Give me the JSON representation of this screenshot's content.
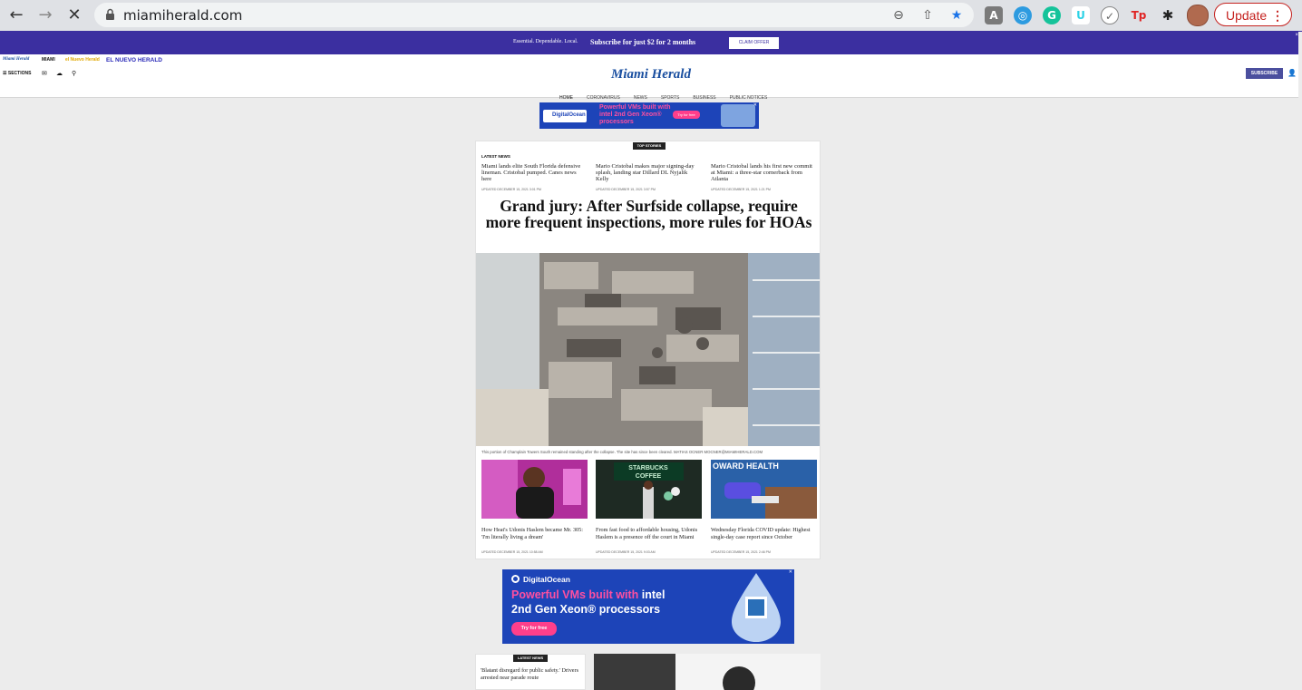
{
  "browser": {
    "url": "miamiherald.com",
    "update_label": "Update",
    "update_dots": "⋮",
    "extensions": [
      {
        "name": "A",
        "color": "#7a7a7a"
      },
      {
        "name": "◎",
        "color": "#2d9be0"
      },
      {
        "name": "G",
        "color": "#15c39a"
      },
      {
        "name": "U",
        "color": "#2dd2e6"
      },
      {
        "name": "✓",
        "color": "#888888"
      },
      {
        "name": "Tp",
        "color": "#e02424"
      },
      {
        "name": "✱",
        "color": "#222222"
      }
    ]
  },
  "promo": {
    "tagline": "Essential. Dependable. Local.",
    "offer": "Subscribe for just $2 for 2 months",
    "claim_label": "CLAIM OFFER",
    "close": "×"
  },
  "sister_sites": [
    "Miami Herald",
    "MIAMI",
    "el Nuevo Herald",
    "EL NUEVO HERALD"
  ],
  "masthead": {
    "logo": "Miami Herald",
    "sections_label": "SECTIONS",
    "subscribe_label": "SUBSCRIBE",
    "nav": [
      "HOME",
      "CORONAVIRUS",
      "NEWS",
      "SPORTS",
      "BUSINESS",
      "PUBLIC NOTICES"
    ]
  },
  "ad_top": {
    "brand": "DigitalOcean",
    "headline": "Powerful VMs built with intel 2nd Gen Xeon® processors",
    "cta": "Try for free"
  },
  "top_stories": {
    "badge": "TOP STORIES",
    "latest_label": "LATEST NEWS",
    "latest": [
      {
        "headline": "Miami lands elite South Florida defensive lineman. Cristobal pumped. Canes news here",
        "updated": "UPDATED DECEMBER 15, 2021 3:01 PM"
      },
      {
        "headline": "Mario Cristobal makes major signing-day splash, landing star Dillard DL Nyjalik Kelly",
        "updated": "UPDATED DECEMBER 15, 2021 3:57 PM"
      },
      {
        "headline": "Mario Cristobal lands his first new commit at Miami: a three-star cornerback from Atlanta",
        "updated": "UPDATED DECEMBER 15, 2021 1:21 PM"
      }
    ],
    "hero_headline": "Grand jury: After Surfside collapse, require more frequent inspections, more rules for HOAs",
    "hero_caption": "This portion of Champlain Towers South remained standing after the collapse. The site has since been cleared. MATIAS OCNER MOCNER@MIAMIHERALD.COM",
    "stories": [
      {
        "headline": "How Heat's Udonis Haslem became Mr. 305: 'I'm literally living a dream'",
        "updated": "UPDATED DECEMBER 15, 2021 10:58 AM"
      },
      {
        "headline": "From fast food to affordable housing, Udonis Haslem is a presence off the court in Miami",
        "updated": "UPDATED DECEMBER 15, 2021 9:03 AM"
      },
      {
        "headline": "Wednesday Florida COVID update: Highest single-day case report since October",
        "updated": "UPDATED DECEMBER 15, 2021 2:46 PM"
      }
    ]
  },
  "ad_bottom": {
    "brand": "DigitalOcean",
    "line1_a": "Powerful VMs built with",
    "line1_b": "intel",
    "line2": "2nd Gen Xeon® processors",
    "cta": "Try for free"
  },
  "latest_section": {
    "badge": "LATEST NEWS",
    "first_headline": "'Blatant disregard for public safety.' Drivers arrested near parade route"
  }
}
